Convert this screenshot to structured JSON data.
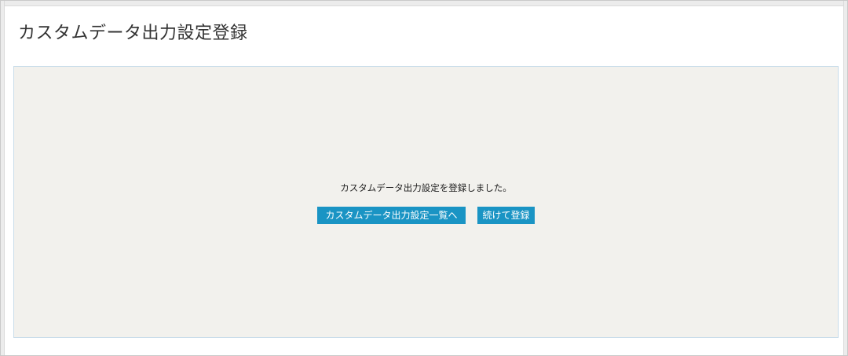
{
  "header": {
    "title": "カスタムデータ出力設定登録"
  },
  "main": {
    "message": "カスタムデータ出力設定を登録しました。",
    "buttons": {
      "list_label": "カスタムデータ出力設定一覧へ",
      "continue_label": "続けて登録"
    }
  },
  "colors": {
    "button_bg": "#1a94c4",
    "panel_bg": "#f2f1ed",
    "panel_border": "#c8dcea"
  }
}
